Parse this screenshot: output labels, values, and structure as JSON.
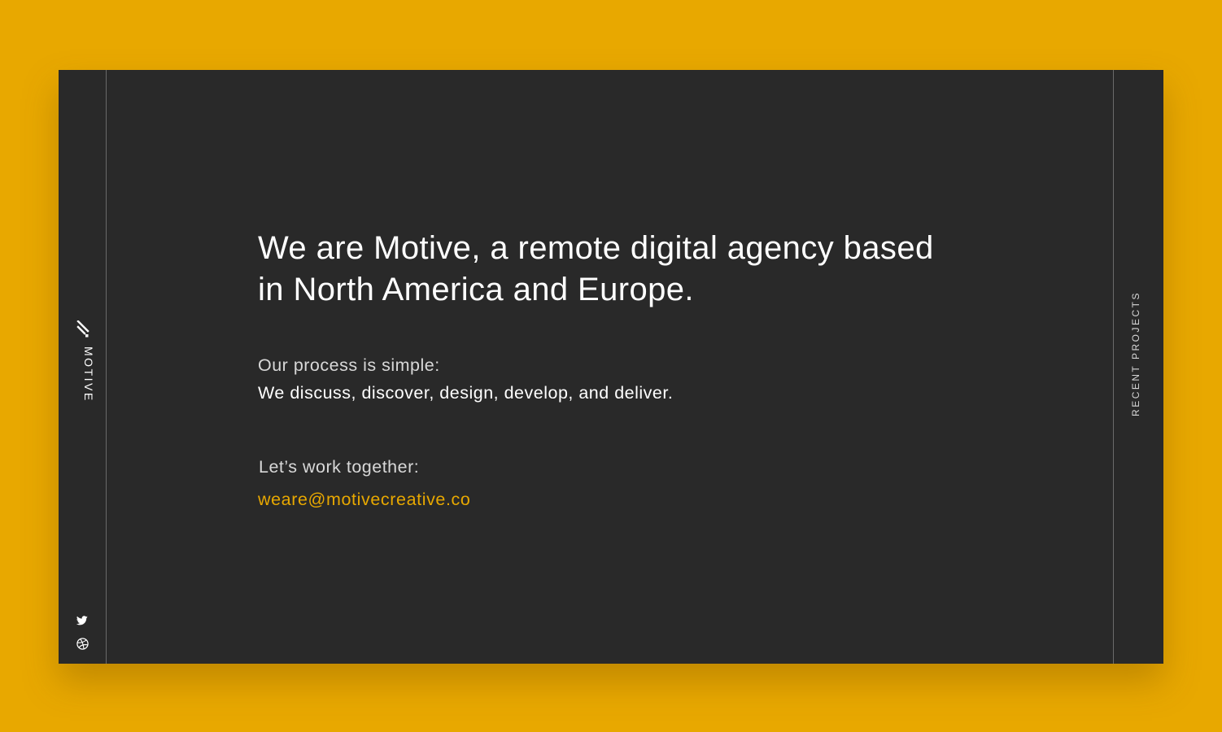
{
  "brand": {
    "name": "MOTIVE",
    "logo_icon": "motive-slash-logo-icon"
  },
  "social": {
    "twitter_icon": "twitter-icon",
    "dribbble_icon": "dribbble-icon"
  },
  "nav": {
    "recent_projects": "RECENT PROJECTS"
  },
  "main": {
    "headline": "We are Motive, a remote digital agency based in North America and Europe.",
    "process_line1": "Our process is simple:",
    "process_line2": "We discuss, discover, design, develop, and deliver.",
    "cta_label": "Let’s work together:",
    "email": "weare@motivecreative.co"
  },
  "colors": {
    "background": "#e8a800",
    "panel": "#292929",
    "accent": "#e8a800",
    "text": "#ffffff"
  }
}
